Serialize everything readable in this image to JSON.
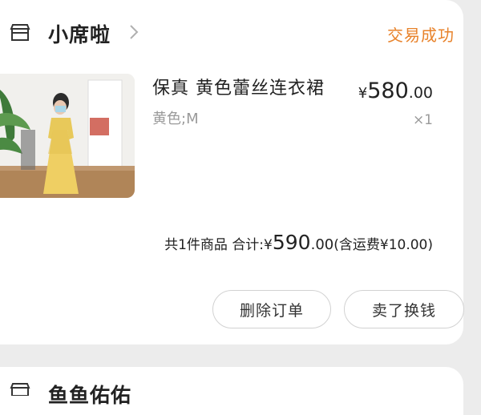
{
  "order": {
    "shop_name": "小席啦",
    "status": "交易成功",
    "item": {
      "title": "保真 黄色蕾丝连衣裙",
      "sku": "黄色;M",
      "price_currency": "¥",
      "price_int": "580",
      "price_dec": ".00",
      "qty": "×1"
    },
    "summary": {
      "count_label": "共1件商品",
      "total_label": "合计:",
      "currency": "¥",
      "total_int": "590",
      "total_dec": ".00",
      "shipping_note": "(含运费",
      "shipping_fee": "¥10.00",
      "close_paren": ")"
    },
    "actions": {
      "delete_label": "删除订单",
      "resell_label": "卖了换钱"
    }
  },
  "next_order": {
    "shop_name": "鱼鱼佑佑"
  },
  "colors": {
    "status": "#e8822a",
    "background": "#ececec",
    "card": "#ffffff"
  },
  "icons": [
    "shop-icon",
    "chevron-right-icon"
  ]
}
